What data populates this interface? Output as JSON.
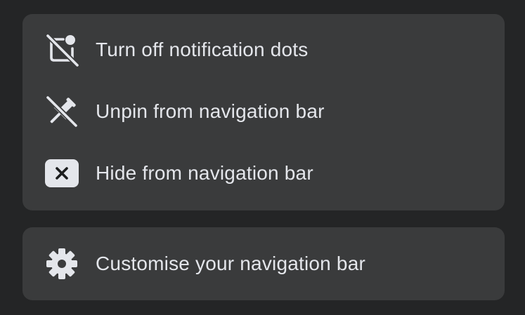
{
  "menu": {
    "actions": [
      {
        "label": "Turn off notification dots",
        "icon": "notification-dots-off-icon"
      },
      {
        "label": "Unpin from navigation bar",
        "icon": "unpin-icon"
      },
      {
        "label": "Hide from navigation bar",
        "icon": "close-box-icon"
      }
    ],
    "customise": {
      "label": "Customise your navigation bar",
      "icon": "gear-icon"
    }
  },
  "colors": {
    "page_background": "#242526",
    "card_background": "#3a3b3c",
    "text": "#e4e6eb",
    "icon": "#e4e6eb"
  }
}
